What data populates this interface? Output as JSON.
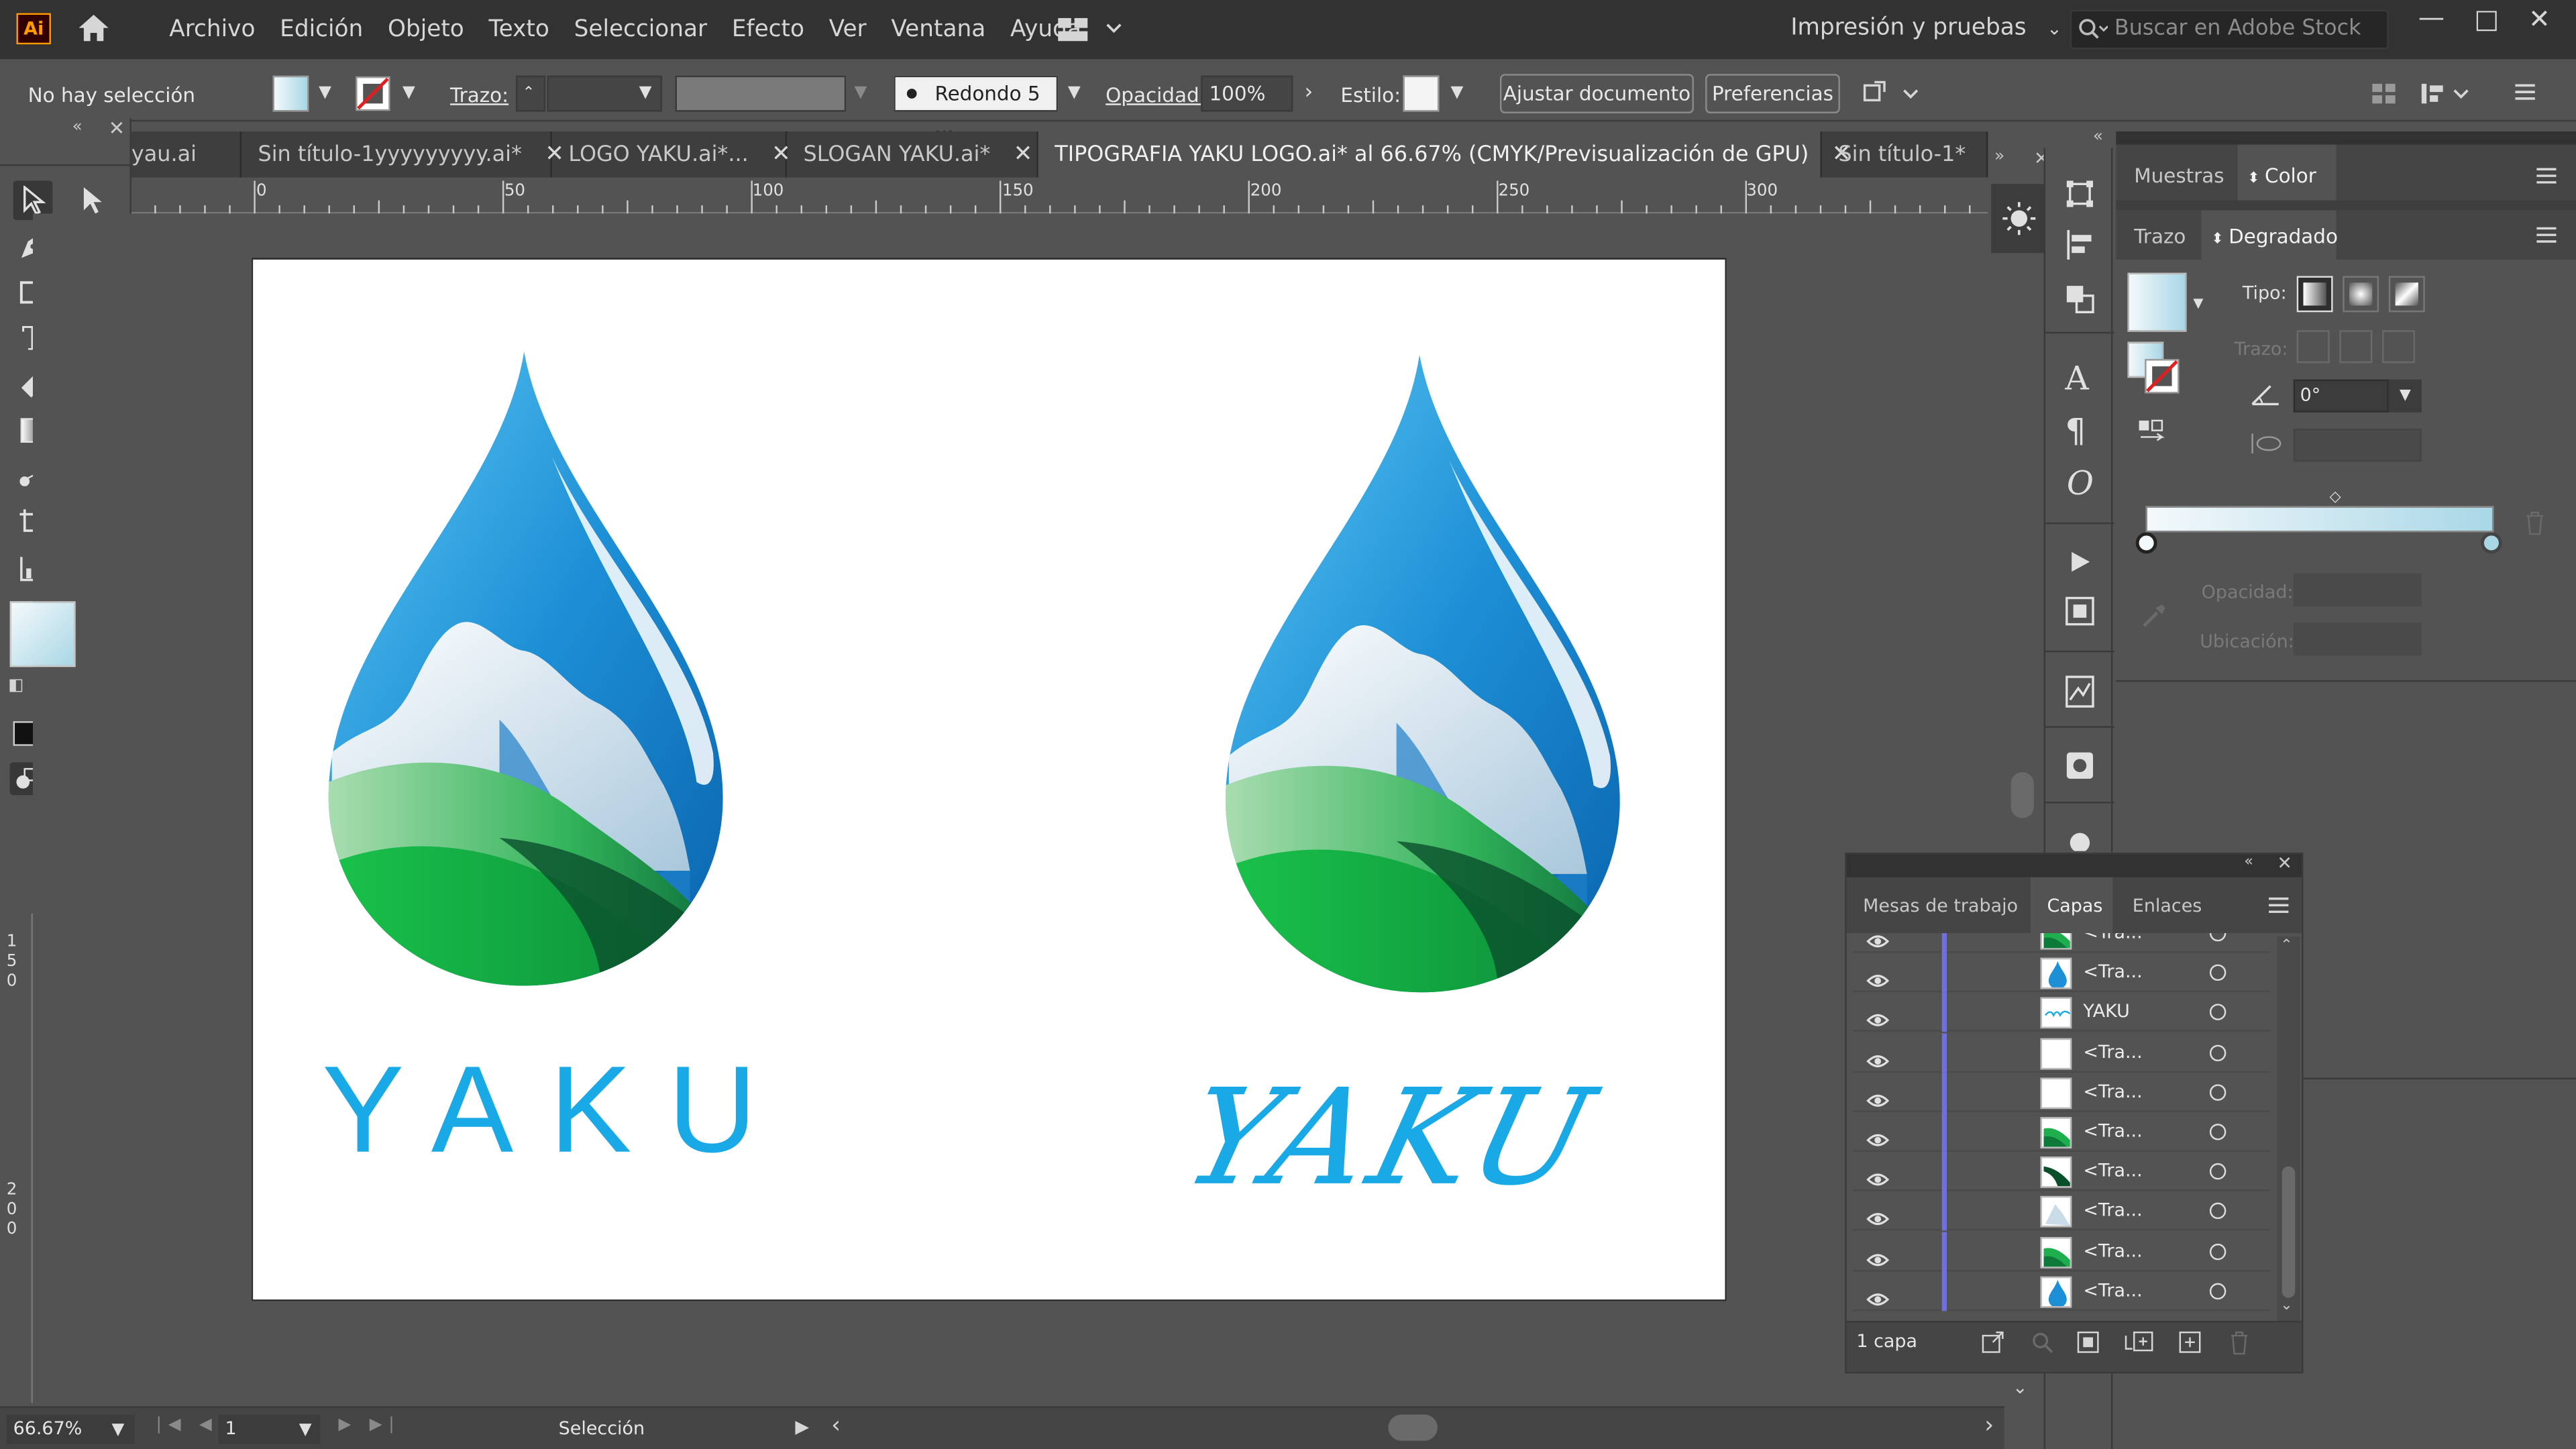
{
  "app": {
    "logo": "Ai"
  },
  "menu": [
    "Archivo",
    "Edición",
    "Objeto",
    "Texto",
    "Seleccionar",
    "Efecto",
    "Ver",
    "Ventana",
    "Ayuda"
  ],
  "workspace": "Impresión y pruebas",
  "stock_search": {
    "placeholder": "Buscar en Adobe Stock"
  },
  "control": {
    "selection": "No hay selección",
    "trazo_label": "Trazo:",
    "brush": "Redondo 5 ...",
    "opacity_label": "Opacidad:",
    "opacity": "100%",
    "style_label": "Estilo:",
    "ajustar": "Ajustar documento",
    "preferencias": "Preferencias"
  },
  "tabs": [
    {
      "label": "yau.ai",
      "active": false
    },
    {
      "label": "Sin título-1yyyyyyyyy.ai*",
      "active": false
    },
    {
      "label": "LOGO YAKU.ai*...",
      "active": false
    },
    {
      "label": "SLOGAN YAKU.ai*",
      "active": false
    },
    {
      "label": "TIPOGRAFIA YAKU LOGO.ai* al 66.67% (CMYK/Previsualización de GPU)",
      "active": true
    },
    {
      "label": "Sin título-1*",
      "active": false
    }
  ],
  "ruler": {
    "h": [
      "0",
      "50",
      "100",
      "150",
      "200",
      "250",
      "300"
    ],
    "v1": "1\n5\n0",
    "v2": "2\n0\n0"
  },
  "artboard": {
    "left_word": "YAKU",
    "right_word": "YAKU"
  },
  "status": {
    "zoom": "66.67%",
    "page": "1",
    "mode": "Selección"
  },
  "gradient_panel": {
    "tab_muestras": "Muestras",
    "tab_color": "Color",
    "tab_trazo": "Trazo",
    "tab_degradado": "Degradado",
    "tipo_label": "Tipo:",
    "trazo_label": "Trazo:",
    "angle": "0°",
    "opacidad_label": "Opacidad:",
    "ubicacion_label": "Ubicación:",
    "start_color": "#f4f9fb",
    "end_color": "#a9d7e6"
  },
  "layers_panel": {
    "tab_mesas": "Mesas de trabajo",
    "tab_capas": "Capas",
    "tab_enlaces": "Enlaces",
    "footer": "1 capa",
    "rows": [
      {
        "name": "<Tra...",
        "icon": "green-swoosh"
      },
      {
        "name": "<Tra...",
        "icon": "blue-drop"
      },
      {
        "name": "YAKU",
        "icon": "script-text"
      },
      {
        "name": "<Tra...",
        "icon": "white"
      },
      {
        "name": "<Tra...",
        "icon": "white"
      },
      {
        "name": "<Tra...",
        "icon": "green-swoosh"
      },
      {
        "name": "<Tra...",
        "icon": "dark-swoosh"
      },
      {
        "name": "<Tra...",
        "icon": "mountain"
      },
      {
        "name": "<Tra...",
        "icon": "green-swoosh"
      },
      {
        "name": "<Tra...",
        "icon": "blue-drop"
      }
    ]
  }
}
